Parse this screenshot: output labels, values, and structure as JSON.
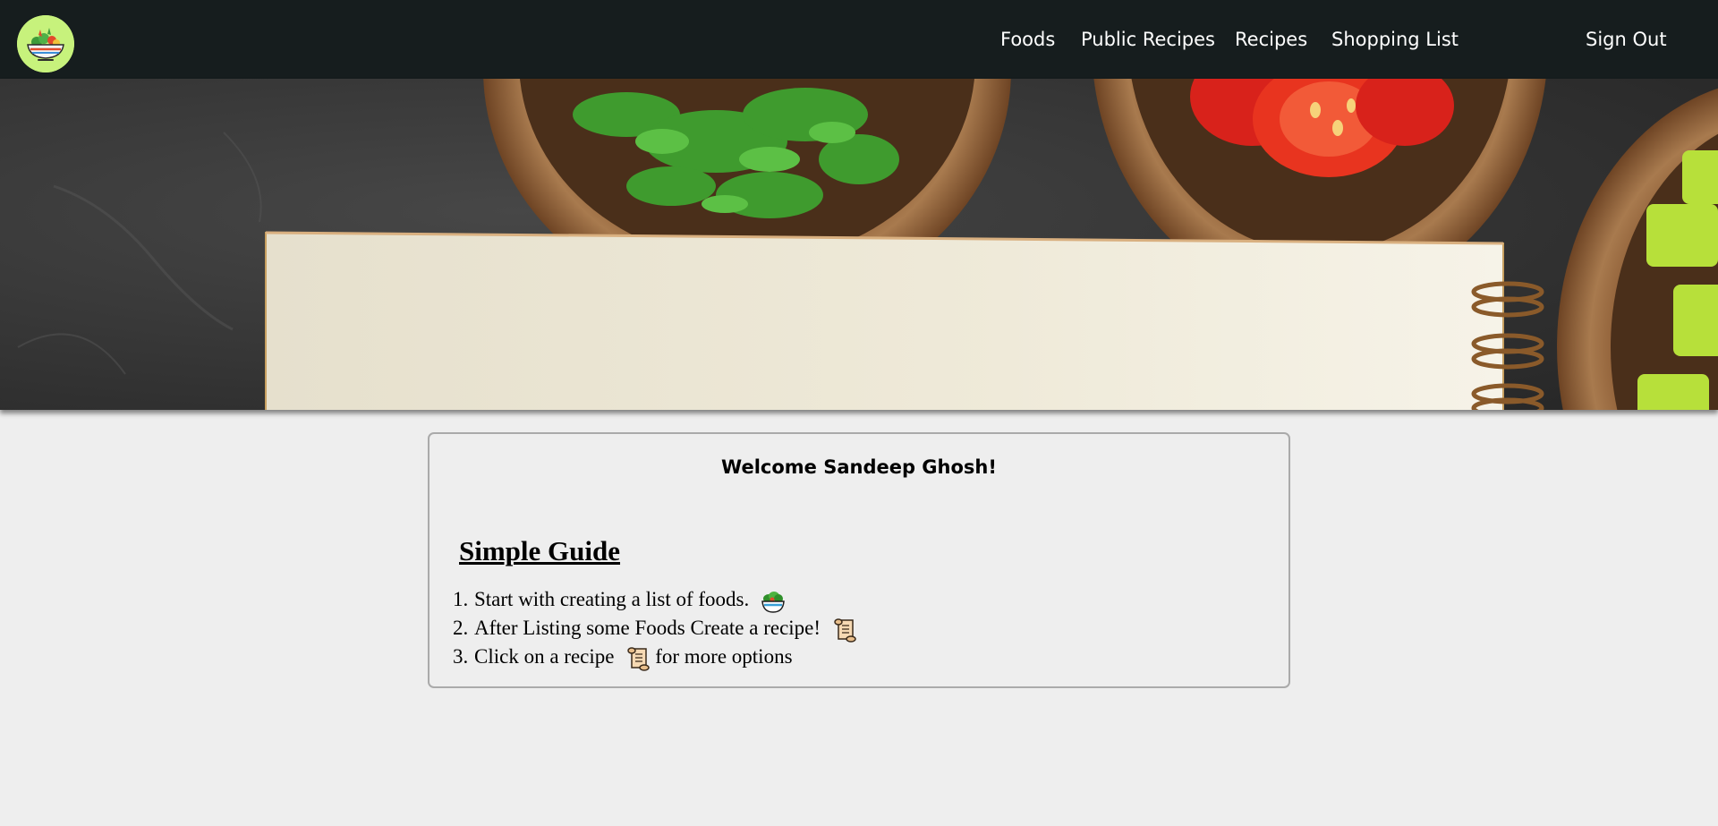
{
  "navbar": {
    "logo_icon": "salad-bowl-logo",
    "links": {
      "foods": "Foods",
      "public_recipes": "Public Recipes",
      "recipes": "Recipes",
      "shopping_list": "Shopping List",
      "sign_out": "Sign Out"
    },
    "background": "#161d1e",
    "text_color": "#ffffff"
  },
  "hero": {
    "image": "notebook-with-herbs-tomatoes-peppers-in-wooden-bowls"
  },
  "card": {
    "welcome": "Welcome Sandeep Ghosh!",
    "guide_title": "Simple Guide",
    "steps": [
      {
        "number": "1.",
        "text_before": "Start with creating a list of foods.",
        "icon": "green-salad-icon",
        "text_after": ""
      },
      {
        "number": "2.",
        "text_before": "After Listing some Foods Create a recipe!",
        "icon": "scroll-icon",
        "text_after": ""
      },
      {
        "number": "3.",
        "text_before": "Click on a recipe",
        "icon": "scroll-icon",
        "text_after": "for more options"
      }
    ]
  }
}
